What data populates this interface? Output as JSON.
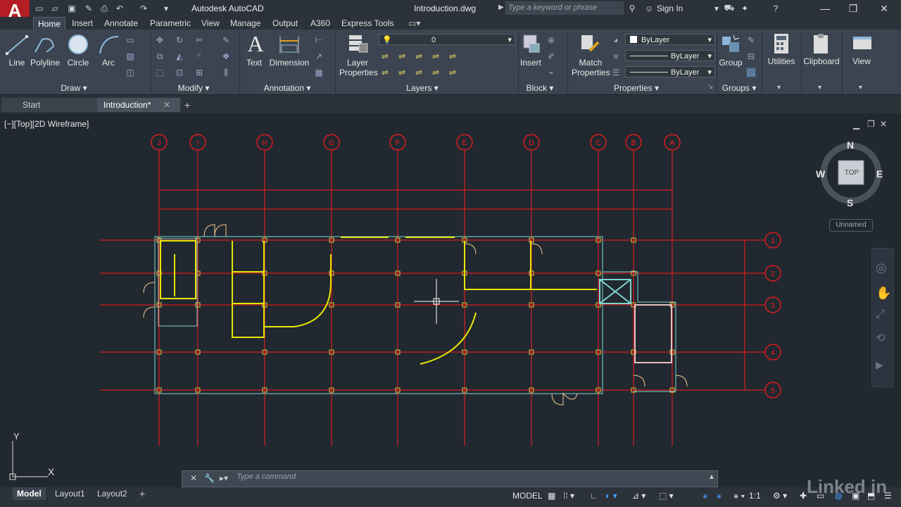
{
  "app": {
    "logo": "A",
    "title": "Autodesk AutoCAD",
    "document": "Introduction.dwg"
  },
  "search": {
    "placeholder": "Type a keyword or phrase"
  },
  "account": {
    "signin": "Sign In"
  },
  "ribbon_tabs": [
    "Home",
    "Insert",
    "Annotate",
    "Parametric",
    "View",
    "Manage",
    "Output",
    "A360",
    "Express Tools"
  ],
  "draw_tools": {
    "line": "Line",
    "polyline": "Polyline",
    "circle": "Circle",
    "arc": "Arc"
  },
  "annotation_tools": {
    "text": "Text",
    "dimension": "Dimension"
  },
  "layer_tools": {
    "layer_properties_1": "Layer",
    "layer_properties_2": "Properties",
    "current_layer": "0"
  },
  "block_tools": {
    "insert": "Insert"
  },
  "properties_tools": {
    "match_1": "Match",
    "match_2": "Properties",
    "color": "ByLayer",
    "linetype": "ByLayer",
    "lineweight": "ByLayer"
  },
  "group_tools": {
    "group": "Group"
  },
  "utility_tools": {
    "utilities": "Utilities",
    "clipboard": "Clipboard",
    "view": "View"
  },
  "panels": {
    "draw": "Draw",
    "modify": "Modify",
    "annotation": "Annotation",
    "layers": "Layers",
    "block": "Block",
    "properties": "Properties",
    "groups": "Groups"
  },
  "file_tabs": {
    "start": "Start",
    "current": "Introduction*"
  },
  "viewport": {
    "label": "[−][Top][2D Wireframe]"
  },
  "viewcube": {
    "n": "N",
    "s": "S",
    "e": "E",
    "w": "W",
    "top": "TOP",
    "ucs": "Unnamed"
  },
  "grid_columns": [
    "J",
    "I",
    "H",
    "G",
    "F",
    "E",
    "D",
    "C",
    "B",
    "A"
  ],
  "grid_rows": [
    "1",
    "2",
    "3",
    "4",
    "5"
  ],
  "ucs_icon": {
    "y": "Y",
    "x": "X"
  },
  "command": {
    "placeholder": "Type  a  command"
  },
  "layout_tabs": [
    "Model",
    "Layout1",
    "Layout2"
  ],
  "status": {
    "model": "MODEL",
    "scale": "1:1"
  },
  "watermark": "Linked in",
  "colors": {
    "drawing_bg": "#212830",
    "grid_red": "#ff1a1a",
    "wall_yellow": "#e6e600",
    "wall_cyan": "#7fd6cf",
    "accent_red": "#b41d23"
  }
}
